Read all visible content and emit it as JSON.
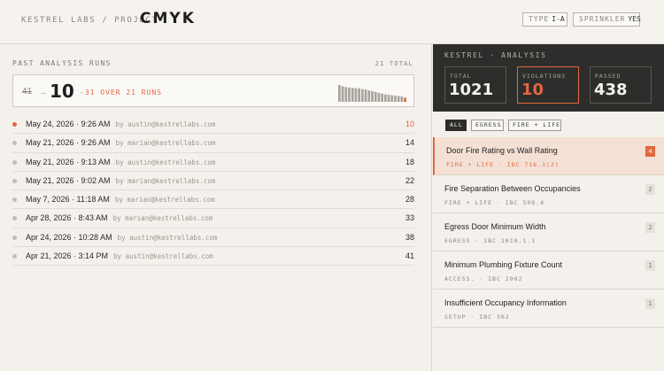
{
  "header": {
    "brand": "KESTREL LABS / PROJECT",
    "project": "CMYK",
    "type_key": "TYPE",
    "type_val": "I-A",
    "sprinkler_key": "SPRINKLER",
    "sprinkler_val": "YES"
  },
  "runs_panel": {
    "title": "PAST ANALYSIS RUNS",
    "total_label": "21 TOTAL",
    "summary": {
      "old_value": "41",
      "arrow": "→",
      "new_value": "10",
      "delta": "-31 OVER 21 RUNS"
    },
    "sparkline": [
      41,
      38,
      36,
      35,
      34,
      33,
      33,
      31,
      30,
      28,
      26,
      24,
      22,
      20,
      18,
      17,
      16,
      15,
      14,
      13,
      10
    ],
    "runs": [
      {
        "date": "May 24, 2026 · 9:26 AM",
        "by": "by austin@kestrellabs.com",
        "count": "10",
        "active": true
      },
      {
        "date": "May 21, 2026 · 9:26 AM",
        "by": "by marian@kestrellabs.com",
        "count": "14",
        "active": false
      },
      {
        "date": "May 21, 2026 · 9:13 AM",
        "by": "by austin@kestrellabs.com",
        "count": "18",
        "active": false
      },
      {
        "date": "May 21, 2026 · 9:02 AM",
        "by": "by marian@kestrellabs.com",
        "count": "22",
        "active": false
      },
      {
        "date": "May 7, 2026 · 11:18 AM",
        "by": "by marian@kestrellabs.com",
        "count": "28",
        "active": false
      },
      {
        "date": "Apr 28, 2026 · 8:43 AM",
        "by": "by marian@kestrellabs.com",
        "count": "33",
        "active": false
      },
      {
        "date": "Apr 24, 2026 · 10:28 AM",
        "by": "by austin@kestrellabs.com",
        "count": "38",
        "active": false
      },
      {
        "date": "Apr 21, 2026 · 3:14 PM",
        "by": "by austin@kestrellabs.com",
        "count": "41",
        "active": false
      }
    ]
  },
  "analysis": {
    "title": "KESTREL · ANALYSIS",
    "stats": {
      "total_label": "TOTAL",
      "total_value": "1021",
      "violations_label": "VIOLATIONS",
      "violations_value": "10",
      "passed_label": "PASSED",
      "passed_value": "438"
    },
    "filters": {
      "all": "ALL",
      "egress": "EGRESS",
      "fire_life": "FIRE + LIFE"
    },
    "items": [
      {
        "title": "Door Fire Rating vs Wall Rating",
        "meta": "FIRE + LIFE · IBC 716.1(2)",
        "count": "4",
        "selected": true
      },
      {
        "title": "Fire Separation Between Occupancies",
        "meta": "FIRE + LIFE · IBC 508.4",
        "count": "2",
        "selected": false
      },
      {
        "title": "Egress Door Minimum Width",
        "meta": "EGRESS · IBC 1010.1.1",
        "count": "2",
        "selected": false
      },
      {
        "title": "Minimum Plumbing Fixture Count",
        "meta": "ACCESS. · IBC 2902",
        "count": "1",
        "selected": false
      },
      {
        "title": "Insufficient Occupancy Information",
        "meta": "SETUP · IBC 302",
        "count": "1",
        "selected": false
      }
    ]
  },
  "colors": {
    "accent": "#e0683e",
    "dark": "#2d2d2b",
    "background": "#f4f1ec"
  }
}
